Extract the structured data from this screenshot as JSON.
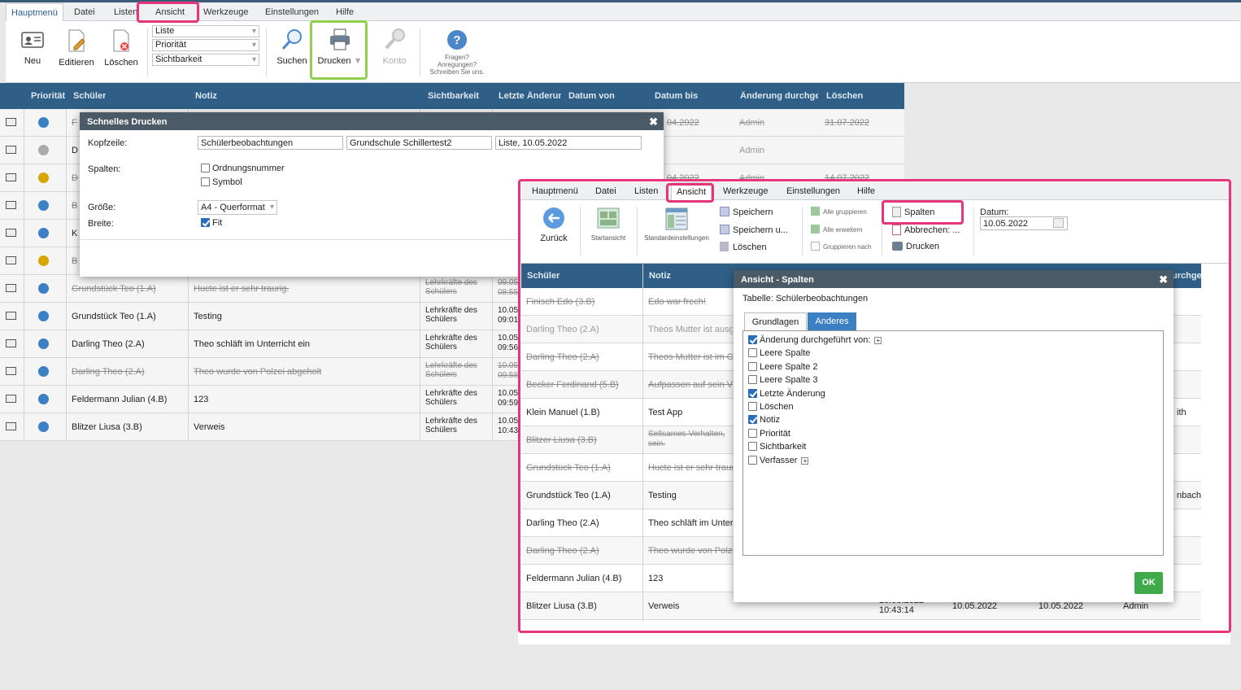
{
  "menu": [
    "Hauptmenü",
    "Datei",
    "Listen",
    "Ansicht",
    "Werkzeuge",
    "Einstellungen",
    "Hilfe"
  ],
  "toolbar": {
    "neu": "Neu",
    "editieren": "Editieren",
    "loeschen": "Löschen",
    "suchen": "Suchen",
    "drucken": "Drucken",
    "konto": "Konto",
    "help": "Fragen? Anregungen? Schreiben Sie uns.",
    "selects": [
      "Liste",
      "Priorität",
      "Sichtbarkeit"
    ]
  },
  "grid": {
    "headers": [
      "Priorität",
      "Schüler",
      "Notiz",
      "Sichtbarkeit",
      "Letzte Änderung",
      "Datum von",
      "Datum bis",
      "Änderung durchgeführt",
      "Löschen"
    ],
    "top_rows": [
      {
        "schueler": "F",
        "datumbis": "04.2022",
        "aend": "Admin",
        "loeschen": "31.07.2022",
        "struck": true
      },
      {
        "schueler": "D",
        "aend": "Admin",
        "struck": false
      },
      {
        "schueler": "D",
        "datumbis": "04.2022",
        "aend": "Admin",
        "loeschen": "14.07.2022",
        "struck": true
      },
      {
        "schueler": "B",
        "struck": true
      },
      {
        "schueler": "K",
        "struck": false
      },
      {
        "schueler": "B",
        "struck": true
      }
    ],
    "rows": [
      {
        "schueler": "Grundstück Teo (1.A)",
        "notiz": "Hucte ist er sehr traurig.",
        "sicht": "Lehrkräfte des Schülers",
        "d1": "09.05",
        "d2": "08:55",
        "struck": true
      },
      {
        "schueler": "Grundstück Teo (1.A)",
        "notiz": "Testing",
        "sicht": "Lehrkräfte des Schülers",
        "d1": "10.05",
        "d2": "09:01",
        "struck": false
      },
      {
        "schueler": "Darling Theo (2.A)",
        "notiz": "Theo schläft im Unterricht ein",
        "sicht": "Lehrkräfte des Schülers",
        "d1": "10.05",
        "d2": "09:56",
        "struck": false
      },
      {
        "schueler": "Darling Theo (2.A)",
        "notiz": "Theo wurde von Polzei abgeholt",
        "sicht": "Lehrkräfte des Schülers",
        "d1": "10.05",
        "d2": "09:58",
        "struck": true
      },
      {
        "schueler": "Feldermann Julian (4.B)",
        "notiz": "123",
        "sicht": "Lehrkräfte des Schülers",
        "d1": "10.05",
        "d2": "09:59",
        "struck": false
      },
      {
        "schueler": "Blitzer Liusa (3.B)",
        "notiz": "Verweis",
        "sicht": "Lehrkräfte des Schülers",
        "d1": "10.05",
        "d2": "10:43",
        "struck": false
      }
    ]
  },
  "print_dialog": {
    "title": "Schnelles Drucken",
    "kopfzeile": "Kopfzeile:",
    "k1": "Schülerbeobachtungen",
    "k2": "Grundschule Schillertest2",
    "k3": "Liste, 10.05.2022",
    "spalten": "Spalten:",
    "ordnung": "Ordnungsnummer",
    "symbol": "Symbol",
    "groesse": "Größe:",
    "format": "A4 - Querformat",
    "breite": "Breite:",
    "fit": "Fit"
  },
  "inset": {
    "ribbon": {
      "zurueck": "Zurück",
      "startansicht": "Startansicht",
      "standard": "Standardeinstellungen",
      "speichern": "Speichern",
      "speichern_u": "Speichern u...",
      "loeschen": "Löschen",
      "alle_grup": "Alle gruppieren",
      "alle_erw": "Alle erweitern",
      "grup_nach": "Gruppieren nach",
      "spalten": "Spalten",
      "abbrechen": "Abbrechen: ...",
      "drucken": "Drucken",
      "datum_label": "Datum:",
      "datum": "10.05.2022"
    },
    "headers": [
      "Schüler",
      "Notiz",
      "urchge"
    ],
    "rows": [
      {
        "schueler": "Finisch Edo (3.B)",
        "notiz": "Edo war frech!",
        "struck": true,
        "dim": false
      },
      {
        "schueler": "Darling Theo (2.A)",
        "notiz": "Theos Mutter ist ausg",
        "struck": false,
        "dim": true
      },
      {
        "schueler": "Darling Theo (2.A)",
        "notiz": "Theos Mutter ist im G",
        "struck": true,
        "dim": false
      },
      {
        "schueler": "Becker Ferdinand (5.B)",
        "notiz": "Aufpassen auf sein Ve",
        "struck": true,
        "dim": false
      },
      {
        "schueler": "Klein Manuel (1.B)",
        "notiz": "Test App",
        "struck": false,
        "dim": false,
        "right": "ith"
      },
      {
        "schueler": "Blitzer Liusa (3.B)",
        "notiz": "Seltsames Verhalten, sein.",
        "struck": true,
        "dim": false
      },
      {
        "schueler": "Grundstück Teo (1.A)",
        "notiz": "Hucte ist er sehr traur",
        "struck": true,
        "dim": false
      },
      {
        "schueler": "Grundstück Teo (1.A)",
        "notiz": "Testing",
        "struck": false,
        "dim": false,
        "right": "nbach"
      },
      {
        "schueler": "Darling Theo (2.A)",
        "notiz": "Theo schläft im Unterr",
        "struck": false,
        "dim": false
      },
      {
        "schueler": "Darling Theo (2.A)",
        "notiz": "Theo wurde von Polze",
        "struck": true,
        "dim": false
      },
      {
        "schueler": "Feldermann Julian (4.B)",
        "notiz": "123",
        "struck": false,
        "dim": false
      },
      {
        "schueler": "Blitzer Liusa (3.B)",
        "notiz": "Verweis",
        "struck": false,
        "dim": false,
        "c1": "10.05.2022",
        "c1b": "10:43:14",
        "c2": "10.05.2022",
        "c3": "10.05.2022",
        "c4": "Admin"
      }
    ]
  },
  "col_dialog": {
    "title": "Ansicht - Spalten",
    "table": "Tabelle: Schülerbeobachtungen",
    "tabs": [
      "Grundlagen",
      "Anderes"
    ],
    "items": [
      {
        "label": "Änderung durchgeführt von:",
        "checked": true,
        "expand": true
      },
      {
        "label": "Leere Spalte",
        "checked": false
      },
      {
        "label": "Leere Spalte 2",
        "checked": false
      },
      {
        "label": "Leere Spalte 3",
        "checked": false
      },
      {
        "label": "Letzte Änderung",
        "checked": true
      },
      {
        "label": "Löschen",
        "checked": false
      },
      {
        "label": "Notiz",
        "checked": true
      },
      {
        "label": "Priorität",
        "checked": false
      },
      {
        "label": "Sichtbarkeit",
        "checked": false
      },
      {
        "label": "Verfasser",
        "checked": false,
        "expand": true
      }
    ],
    "ok": "OK"
  }
}
